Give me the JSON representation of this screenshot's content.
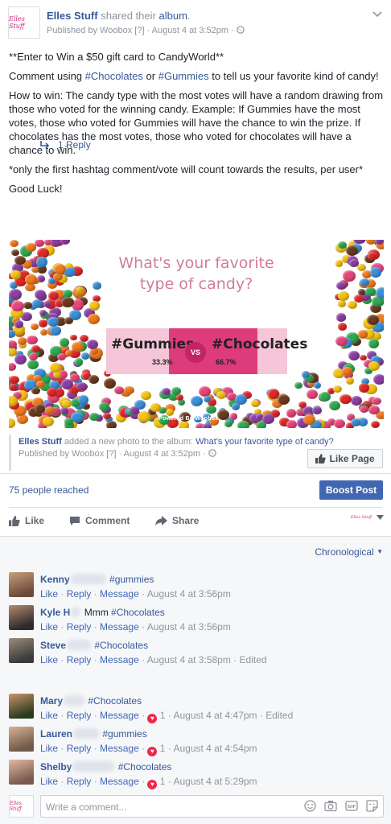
{
  "header": {
    "page_name": "Elles Stuff",
    "shared_text": "shared their",
    "album_word": "album",
    "published_by": "Published by Woobox",
    "help_mark": "[?]",
    "date": "August 4 at 3:52pm",
    "page_logo_text": "Elles Stuff"
  },
  "post": {
    "line1": "**Enter to Win a $50 gift card to CandyWorld**",
    "line2_pre": "Comment using ",
    "hashtag_chocolates": "#Chocolates",
    "line2_or": " or ",
    "hashtag_gummies": "#Gummies",
    "line2_post": " to tell us your favorite kind of candy!",
    "line3": "How to win: The candy type with the most votes will have a random drawing from those who voted for the winning candy. Example: If Gummies have the most votes, those who voted for Gummies will have the chance to win the prize. If chocolates has the most votes, those who voted for chocolates will have a chance to win.",
    "line4": "*only the first hashtag comment/vote will count towards the results, per user*",
    "line5": "Good Luck!"
  },
  "image": {
    "title_line1": "What's your favorite",
    "title_line2": "type of candy?",
    "option1": "#Gummies",
    "option2": "#Chocolates",
    "vs": "VS",
    "pct1": "33.3%",
    "pct2": "66.7%",
    "powered": "Powered By Woobox",
    "colors": [
      "#e02828",
      "#f5c211",
      "#3a8fd8",
      "#2fa84f",
      "#f07a1c",
      "#8b3fa3",
      "#e6457a",
      "#6b3b1e"
    ]
  },
  "album": {
    "page_name": "Elles Stuff",
    "text": " added a new photo to the album: ",
    "album_title": "What's your favorite type of candy?",
    "published_by": "Published by Woobox",
    "help_mark": "[?]",
    "date": "August 4 at 3:52pm",
    "like_page": "Like Page"
  },
  "reach": {
    "text": "75 people reached",
    "boost": "Boost Post"
  },
  "actions": {
    "like": "Like",
    "comment": "Comment",
    "share": "Share"
  },
  "comments": {
    "sort": "Chronological",
    "write_placeholder": "Write a comment...",
    "reply_count": "1 Reply",
    "like_label": "Like",
    "reply_label": "Reply",
    "message_label": "Message",
    "items": [
      {
        "name": "Kenny",
        "text": "#gummies",
        "date": "August 4 at 3:56pm",
        "reactions": "",
        "edited": ""
      },
      {
        "name": "Kyle H",
        "text_pre": "Mmm ",
        "text": "#Chocolates",
        "date": "August 4 at 3:56pm",
        "reactions": "",
        "edited": ""
      },
      {
        "name": "Steve",
        "text": "#Chocolates",
        "date": "August 4 at 3:58pm",
        "reactions": "",
        "edited": "Edited"
      },
      {
        "name": "Mary",
        "text": "#Chocolates",
        "date": "August 4 at 4:47pm",
        "reactions": "1",
        "edited": "Edited"
      },
      {
        "name": "Lauren",
        "text": "#gummies",
        "date": "August 4 at 4:54pm",
        "reactions": "1",
        "edited": ""
      },
      {
        "name": "Shelby",
        "text": "#Chocolates",
        "date": "August 4 at 5:29pm",
        "reactions": "1",
        "edited": ""
      }
    ]
  }
}
